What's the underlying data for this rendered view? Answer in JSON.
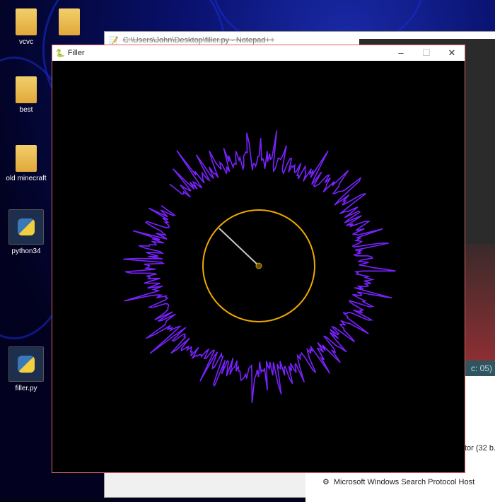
{
  "desktop": {
    "icons": [
      {
        "label": "vcvc"
      },
      {
        "label": ""
      },
      {
        "label": "best"
      },
      {
        "label": "old minecraft"
      },
      {
        "label": "python34"
      },
      {
        "label": "filler.py"
      }
    ]
  },
  "notepad": {
    "title": "C:\\Users\\John\\Desktop\\filler.py - Notepad++",
    "status_fragment": "c: 05)"
  },
  "task_manager": {
    "rows": [
      {
        "label": "tor (32 b..."
      },
      {
        "label": "Microsoft Windows Search Protocol Host"
      }
    ]
  },
  "pygame": {
    "title": "Filler",
    "minimize": "–",
    "maximize": "☐",
    "close": "✕"
  },
  "colors": {
    "ring": "#f0a800",
    "spikes": "#7a22ff",
    "pointer": "#c8c8c8"
  }
}
